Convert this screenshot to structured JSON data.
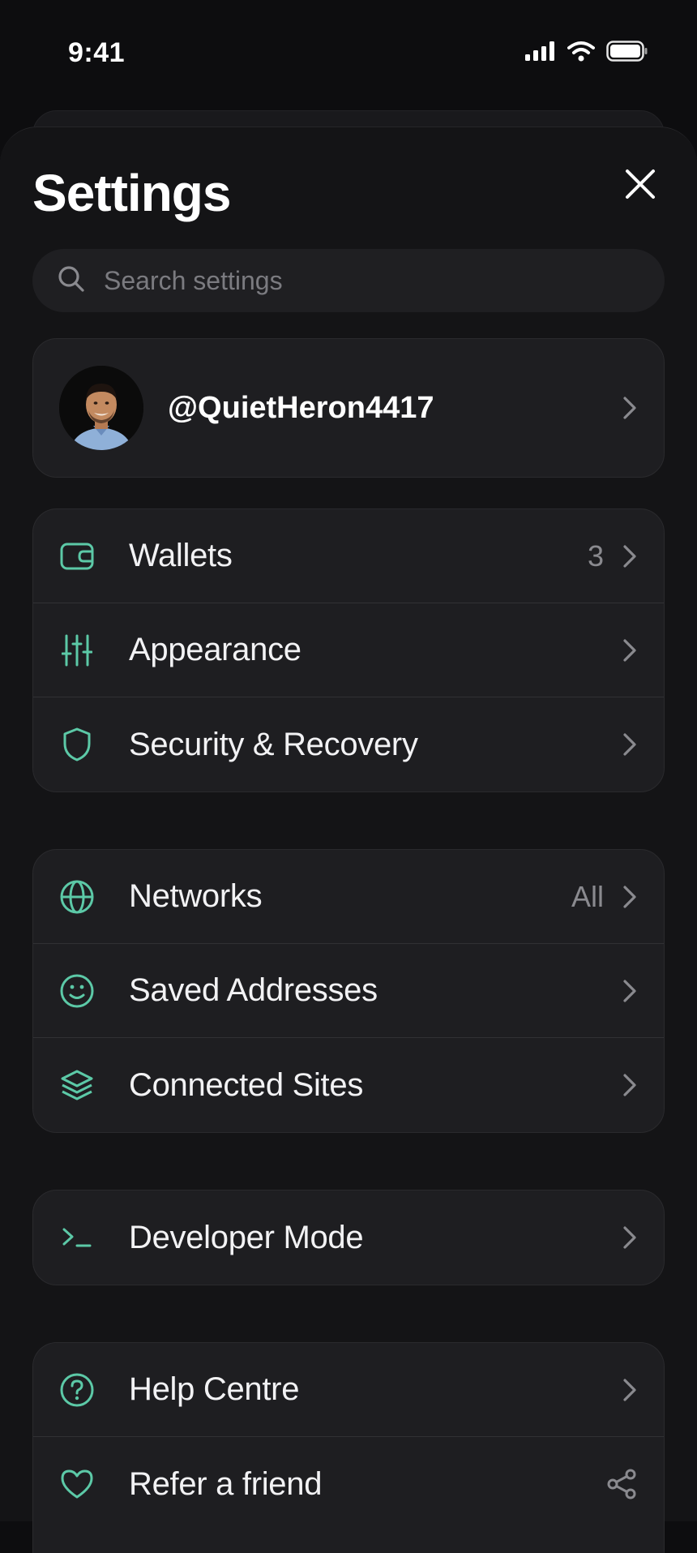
{
  "status_bar": {
    "time": "9:41"
  },
  "header": {
    "title": "Settings"
  },
  "search": {
    "placeholder": "Search settings",
    "value": ""
  },
  "profile": {
    "username": "@QuietHeron4417"
  },
  "groups": [
    [
      {
        "label": "Wallets",
        "value": "3",
        "icon": "wallet-icon"
      },
      {
        "label": "Appearance",
        "value": "",
        "icon": "sliders-icon"
      },
      {
        "label": "Security & Recovery",
        "value": "",
        "icon": "shield-icon"
      }
    ],
    [
      {
        "label": "Networks",
        "value": "All",
        "icon": "globe-icon"
      },
      {
        "label": "Saved Addresses",
        "value": "",
        "icon": "smiley-icon"
      },
      {
        "label": "Connected Sites",
        "value": "",
        "icon": "layers-icon"
      }
    ],
    [
      {
        "label": "Developer Mode",
        "value": "",
        "icon": "terminal-icon"
      }
    ],
    [
      {
        "label": "Help Centre",
        "value": "",
        "icon": "help-circle-icon"
      },
      {
        "label": "Refer a friend",
        "value": "",
        "icon": "heart-icon"
      }
    ]
  ],
  "colors": {
    "accent": "#5cc9a7",
    "background": "#0d0d0f",
    "card": "#1e1e21",
    "muted": "#8a8a8f"
  }
}
